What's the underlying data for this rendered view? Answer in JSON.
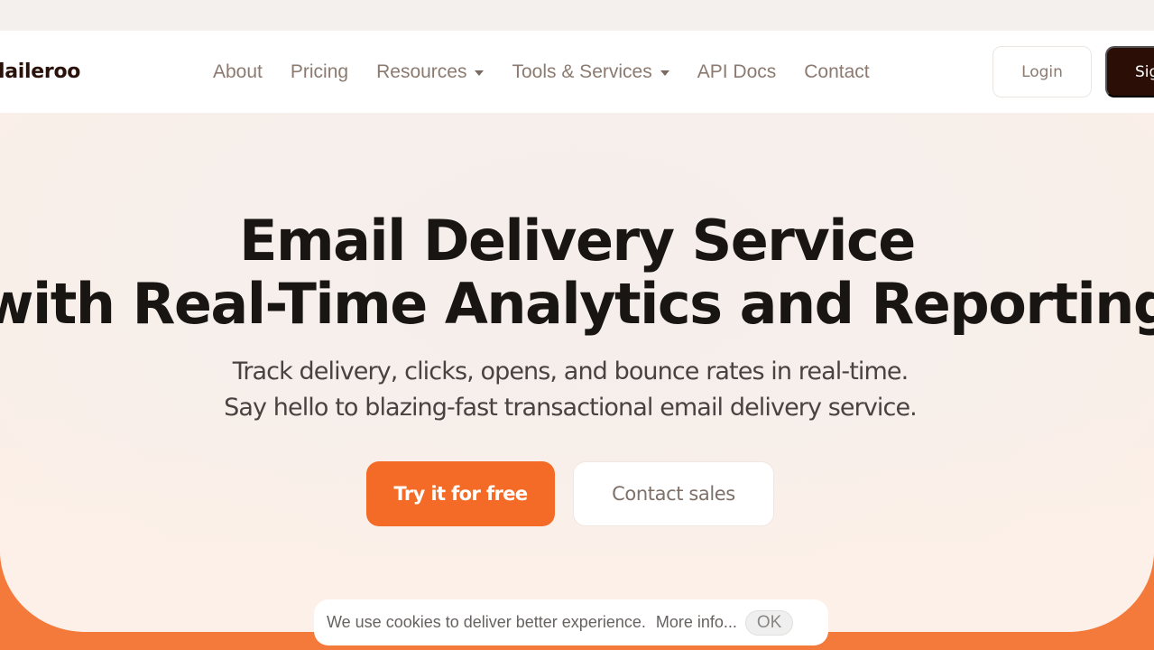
{
  "colors": {
    "brand_dark": "#2b0e05",
    "accent_orange": "#f46b27",
    "band_orange": "#f47a3c",
    "nav_text": "#8c7a70",
    "headline_text": "#181512"
  },
  "navbar": {
    "logo_text": "Maileroo",
    "logo_visible_text": "laileroo",
    "links": [
      {
        "label": "About",
        "has_dropdown": false
      },
      {
        "label": "Pricing",
        "has_dropdown": false
      },
      {
        "label": "Resources",
        "has_dropdown": true,
        "icon": "caret-down-icon"
      },
      {
        "label": "Tools & Services",
        "has_dropdown": true,
        "icon": "caret-down-icon"
      },
      {
        "label": "API Docs",
        "has_dropdown": false
      },
      {
        "label": "Contact",
        "has_dropdown": false
      }
    ],
    "login_label": "Login",
    "signup_label": "Sign up",
    "signup_visible_label": "Sig"
  },
  "hero": {
    "headline_line1": "Email Delivery Service",
    "headline_line2": "with Real-Time Analytics and Reporting",
    "subhead_line1": "Track delivery, clicks, opens, and bounce rates in real-time.",
    "subhead_line2": "Say hello to blazing-fast transactional email delivery service.",
    "primary_cta": "Try it for free",
    "secondary_cta": "Contact sales"
  },
  "cookie_banner": {
    "message": "We use cookies to deliver better experience.",
    "more_info_label": "More info...",
    "ok_label": "OK"
  }
}
